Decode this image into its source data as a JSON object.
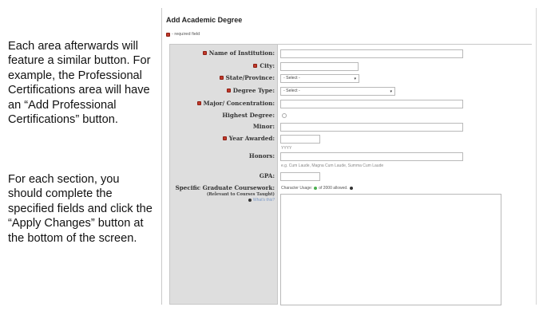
{
  "instructions": {
    "para1": "Each area afterwards will feature a similar button. For example, the Professional Certifications area will have an “Add Professional Certifications” button.",
    "para2": "For each section, you should complete the specified fields and click the “Apply Changes” button at the bottom of the screen."
  },
  "form": {
    "title": "Add Academic Degree",
    "required_note": "- required field",
    "fields": {
      "institution": {
        "label": "Name of Institution:"
      },
      "city": {
        "label": "City:"
      },
      "state": {
        "label": "State/Province:",
        "value": "- Select -"
      },
      "degree_type": {
        "label": "Degree Type:",
        "value": "- Select -"
      },
      "major": {
        "label": "Major/ Concentration:"
      },
      "highest_degree": {
        "label": "Highest Degree:"
      },
      "minor": {
        "label": "Minor:"
      },
      "year_awarded": {
        "label": "Year Awarded:",
        "hint": "YYYY"
      },
      "honors": {
        "label": "Honors:",
        "hint": "e.g. Cum Laude, Magna Cum Laude, Summa Cum Laude"
      },
      "gpa": {
        "label": "GPA:"
      },
      "coursework": {
        "label": "Specific Graduate Coursework:",
        "sublabel": "(Relevant to Courses Taught)",
        "whats_this": "What's this?",
        "char_usage_prefix": "Character Usage:",
        "char_usage_suffix": "of 2000 allowed."
      }
    }
  },
  "colors": {
    "required": "#c0392b",
    "label_bg": "#dedede"
  },
  "icons": {
    "required": "required-marker-icon",
    "info": "info-icon",
    "char_ok": "status-ok-icon",
    "chevron": "chevron-down-icon"
  }
}
